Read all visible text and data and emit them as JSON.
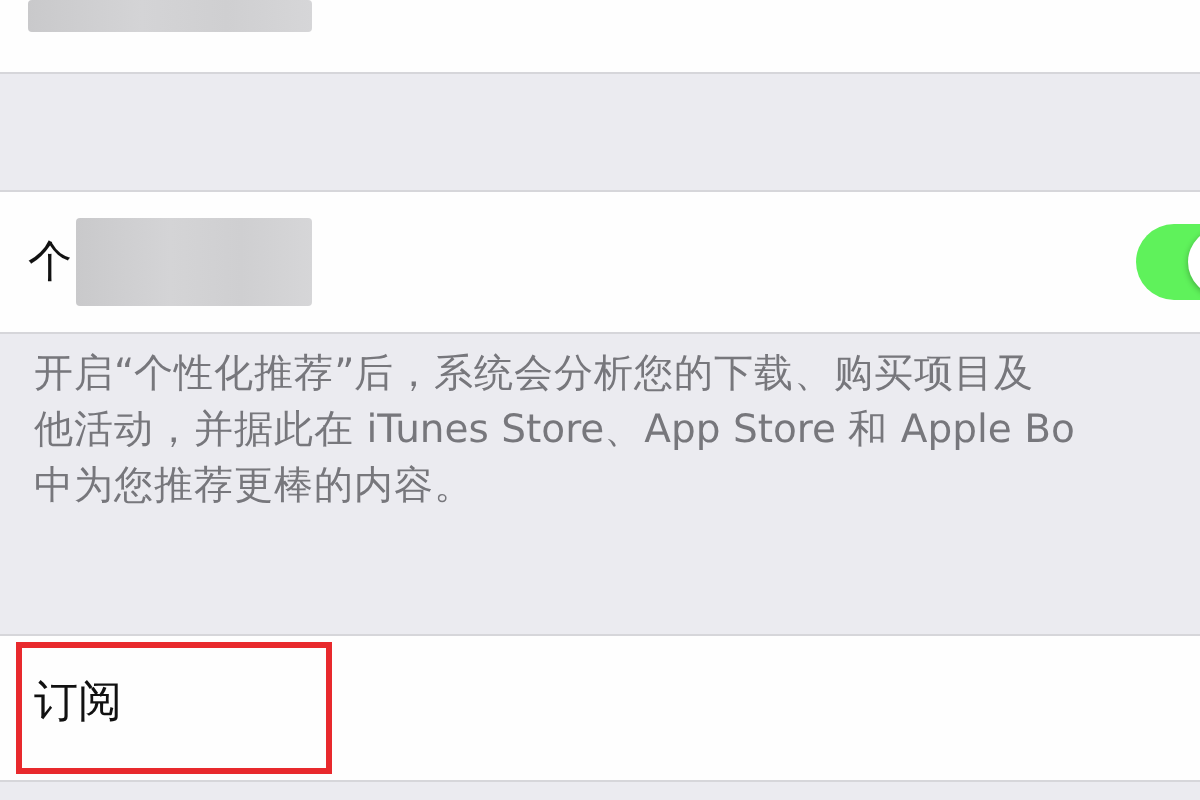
{
  "recommendation_cell": {
    "label": "个",
    "on": true
  },
  "recommendation_footer": [
    "开启“个性化推荐”后，系统会分析您的下载、购买项目及",
    "他活动，并据此在 iTunes Store、App Store 和 Apple Bo",
    "中为您推荐更棒的内容。"
  ],
  "subscriptions_cell": {
    "label": "订阅",
    "highlighted": true
  }
}
